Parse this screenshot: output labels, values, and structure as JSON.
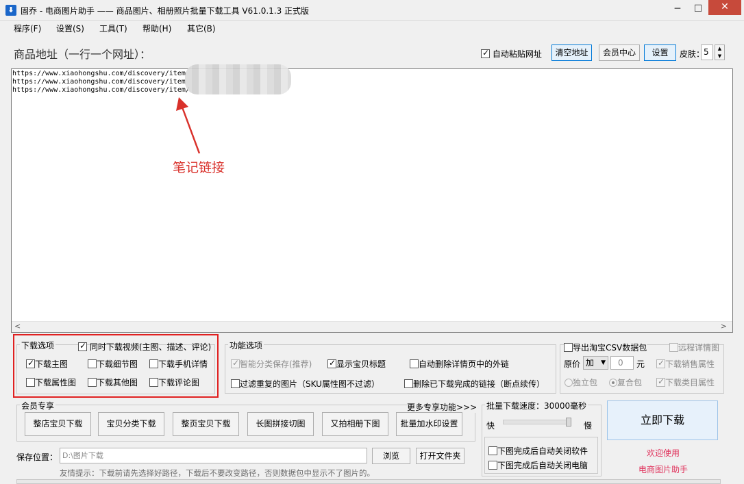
{
  "window": {
    "title": "固乔 - 电商图片助手 —— 商品图片、相册照片批量下载工具 V61.0.1.3 正式版",
    "minimize": "─",
    "maximize": "☐",
    "close": "✕"
  },
  "menu": [
    "程序(F)",
    "设置(S)",
    "工具(T)",
    "帮助(H)",
    "其它(B)"
  ],
  "address": {
    "title": "商品地址（一行一个网址）：",
    "auto_paste_label": "自动粘贴网址",
    "auto_paste_checked": true,
    "clear_button": "清空地址",
    "member_button": "会员中心",
    "settings_button": "设置",
    "skin_label": "皮肤：",
    "skin_value": "5",
    "urls": [
      "https://www.xiaohongshu.com/discovery/item",
      "https://www.xiaohongshu.com/discovery/item",
      "https://www.xiaohongshu.com/discovery/item/"
    ],
    "annotation": "笔记链接"
  },
  "download_options": {
    "legend": "下载选项",
    "video_label": "同时下载视频(主图、描述、评论)",
    "video_checked": true,
    "items": [
      {
        "label": "下载主图",
        "checked": true
      },
      {
        "label": "下载细节图",
        "checked": false
      },
      {
        "label": "下载手机详情",
        "checked": false
      },
      {
        "label": "下载属性图",
        "checked": false
      },
      {
        "label": "下载其他图",
        "checked": false
      },
      {
        "label": "下载评论图",
        "checked": false
      }
    ]
  },
  "function_options": {
    "legend": "功能选项",
    "items": [
      {
        "label": "智能分类保存(推荐)",
        "checked": true,
        "disabled": true
      },
      {
        "label": "显示宝贝标题",
        "checked": true,
        "disabled": false
      },
      {
        "label": "自动删除详情页中的外链",
        "checked": false,
        "disabled": false
      },
      {
        "label": "过滤重复的图片（SKU属性图不过滤）",
        "checked": false,
        "disabled": false
      },
      {
        "label": "删除已下载完成的链接（断点续传）",
        "checked": false,
        "disabled": false
      }
    ]
  },
  "csv_options": {
    "export_label": "导出淘宝CSV数据包",
    "remote_label": "远程详情图",
    "price_label": "原价",
    "price_op": "加",
    "price_value": "0",
    "price_unit": "元",
    "sales_attr_label": "下载销售属性",
    "standalone_label": "独立包",
    "combined_label": "复合包",
    "category_attr_label": "下载类目属性"
  },
  "member": {
    "legend": "会员专享",
    "more_link": "更多专享功能>>>",
    "buttons": [
      "整店宝贝下载",
      "宝贝分类下载",
      "整页宝贝下载",
      "长图拼接切图",
      "又拍相册下图",
      "批量加水印设置"
    ]
  },
  "speed": {
    "legend": "批量下载速度：30000毫秒",
    "fast": "快",
    "slow": "慢",
    "level": 0.95,
    "close_software": "下图完成后自动关闭软件",
    "close_computer": "下图完成后自动关闭电脑"
  },
  "save": {
    "label": "保存位置：",
    "path": "D:\\图片下载",
    "browse_button": "浏览",
    "open_button": "打开文件夹",
    "hint": "友情提示：下载前请先选择好路径，下载后不要改变路径，否则数据包中显示不了图片的。"
  },
  "download_button": "立即下载",
  "welcome_line1": "欢迎使用",
  "welcome_line2": "电商图片助手"
}
